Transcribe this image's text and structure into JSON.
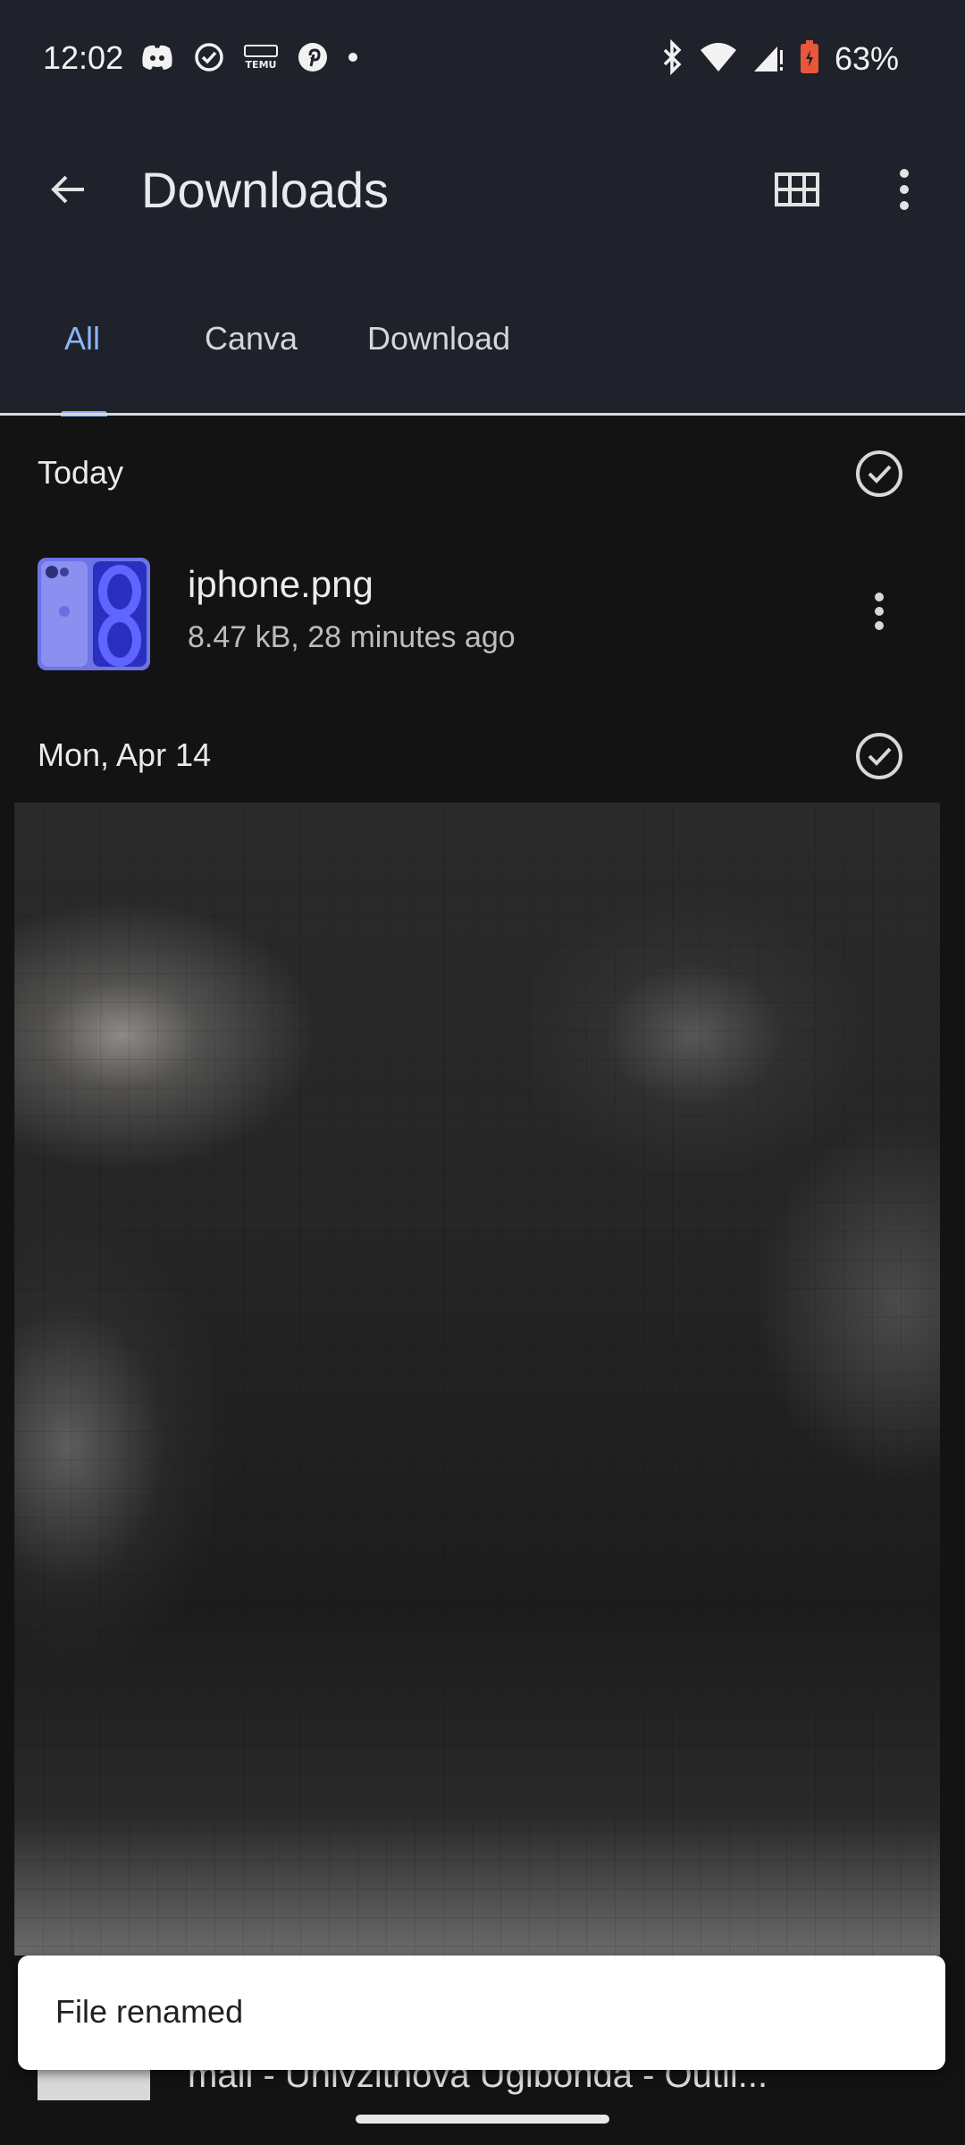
{
  "status_bar": {
    "time": "12:02",
    "left_icons": [
      "discord-icon",
      "check-circle-icon",
      "temu-icon",
      "pinterest-icon",
      "dot-icon"
    ],
    "right_icons": [
      "bluetooth-icon",
      "wifi-icon",
      "signal-icon",
      "battery-icon"
    ],
    "battery": "63%"
  },
  "toolbar": {
    "title": "Downloads",
    "back_icon": "arrow-back-icon",
    "grid_icon": "grid-view-icon",
    "more_icon": "more-vert-icon"
  },
  "tabs": [
    {
      "label": "All",
      "active": true
    },
    {
      "label": "Canva",
      "active": false
    },
    {
      "label": "Download",
      "active": false
    }
  ],
  "sections": [
    {
      "title": "Today"
    },
    {
      "title": "Mon, Apr 14"
    }
  ],
  "files": [
    {
      "name": "iphone.png",
      "meta": "8.47 kB, 28 minutes ago"
    }
  ],
  "peek_row": {
    "text": "mail - Univzitnova Uglbonda - Outil..."
  },
  "snackbar": {
    "message": "File renamed"
  },
  "colors": {
    "header_bg": "#1f222a",
    "page_bg": "#131313",
    "accent": "#8ab4f8",
    "snackbar_bg": "#ffffff"
  }
}
